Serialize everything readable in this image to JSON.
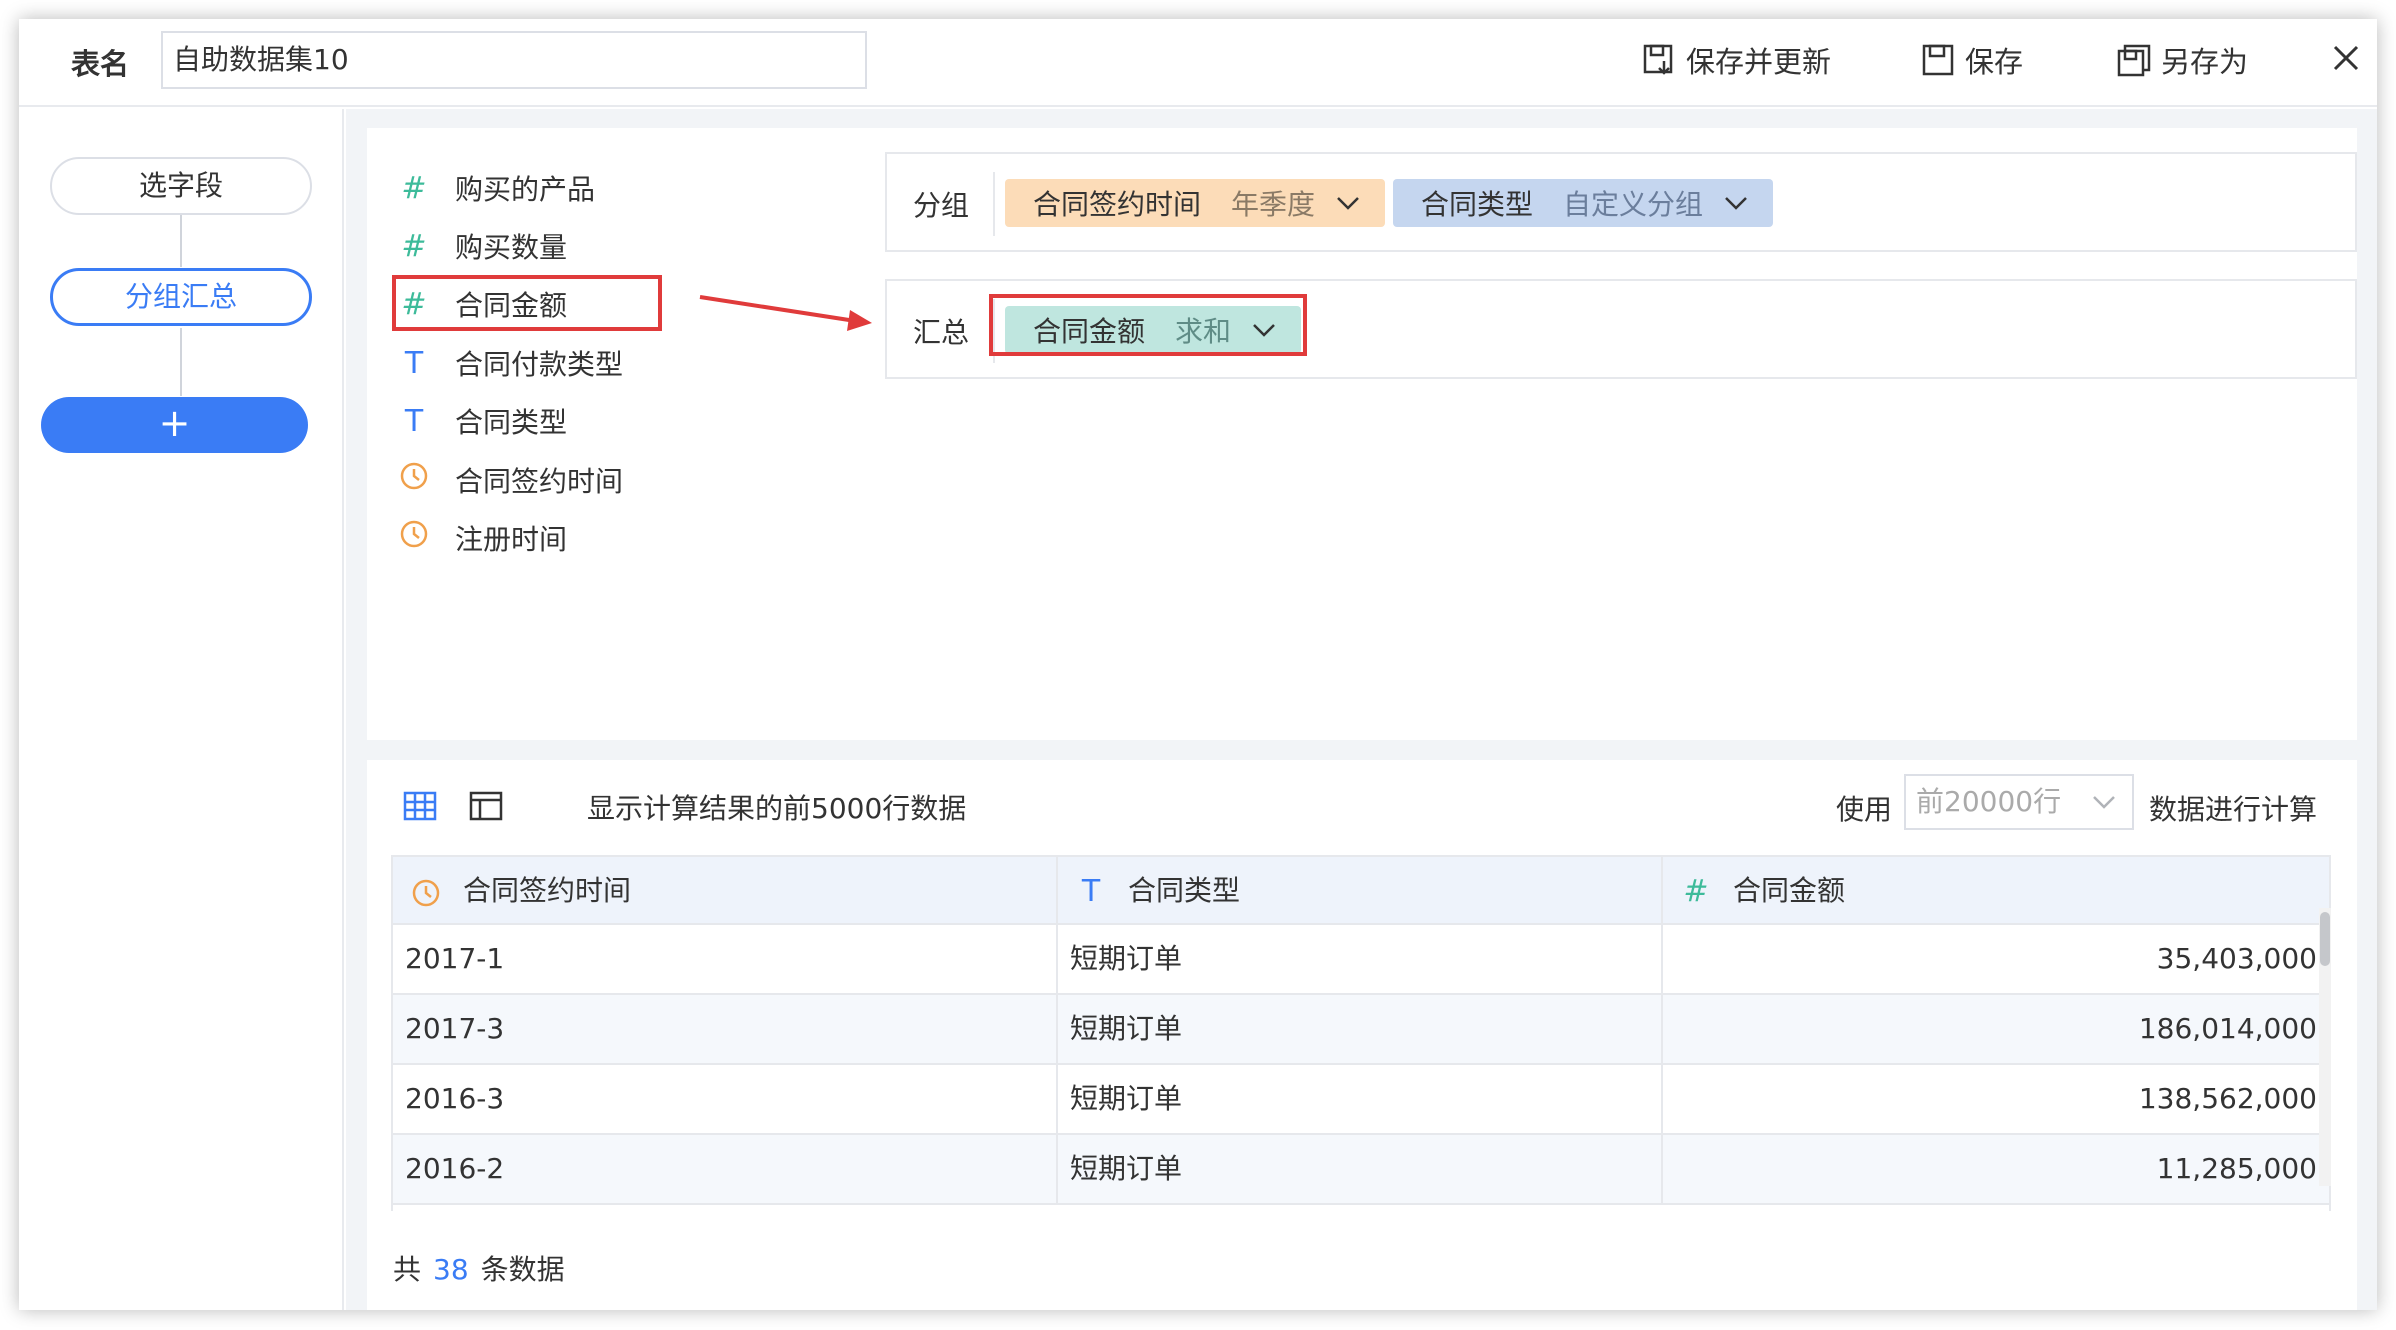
{
  "header": {
    "table_name_label": "表名",
    "table_name_value": "自助数据集10",
    "save_update_label": "保存并更新",
    "save_label": "保存",
    "save_as_label": "另存为"
  },
  "steps": {
    "select_fields": "选字段",
    "group_summary": "分组汇总",
    "add": "+"
  },
  "fields": [
    {
      "type": "number",
      "icon": "#",
      "label": "购买的产品"
    },
    {
      "type": "number",
      "icon": "#",
      "label": "购买数量"
    },
    {
      "type": "number",
      "icon": "#",
      "label": "合同金额"
    },
    {
      "type": "text",
      "icon": "T",
      "label": "合同付款类型"
    },
    {
      "type": "text",
      "icon": "T",
      "label": "合同类型"
    },
    {
      "type": "date",
      "icon": "clock",
      "label": "合同签约时间"
    },
    {
      "type": "date",
      "icon": "clock",
      "label": "注册时间"
    }
  ],
  "group_zone": {
    "label": "分组",
    "chips": [
      {
        "field": "合同签约时间",
        "option": "年季度"
      },
      {
        "field": "合同类型",
        "option": "自定义分组"
      }
    ]
  },
  "summary_zone": {
    "label": "汇总",
    "chips": [
      {
        "field": "合同金额",
        "option": "求和"
      }
    ]
  },
  "toolbar": {
    "info": "显示计算结果的前5000行数据",
    "use_label": "使用",
    "row_limit": "前20000行",
    "calc_label": "数据进行计算"
  },
  "table": {
    "columns": [
      "合同签约时间",
      "合同类型",
      "合同金额"
    ],
    "rows": [
      [
        "2017-1",
        "短期订单",
        "35,403,000"
      ],
      [
        "2017-3",
        "短期订单",
        "186,014,000"
      ],
      [
        "2016-3",
        "短期订单",
        "138,562,000"
      ],
      [
        "2016-2",
        "短期订单",
        "11,285,000"
      ]
    ]
  },
  "footer": {
    "prefix": "共",
    "count": "38",
    "suffix": "条数据"
  },
  "colors": {
    "accent": "#3a7cf5",
    "number_icon": "#3dbb9a",
    "date_icon": "#f0a04b",
    "highlight": "#e03b3b",
    "chip_orange": "#fcdcb8",
    "chip_blue": "#c5d6ef",
    "chip_teal": "#bfe6df"
  }
}
